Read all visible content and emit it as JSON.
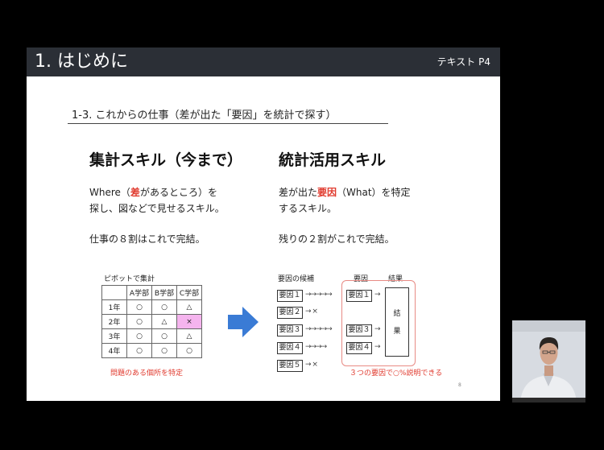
{
  "header": {
    "title": "1. はじめに",
    "reference": "テキスト P4"
  },
  "subtitle": "1-3. これからの仕事（差が出た「要因」を統計で探す）",
  "left": {
    "heading": "集計スキル（今まで）",
    "line1_pre": "Where（",
    "line1_red": "差",
    "line1_post": "があるところ）を",
    "line2": "探し、図などで見せるスキル。",
    "line3": "仕事の８割はこれで完結。"
  },
  "right": {
    "heading": "統計活用スキル",
    "line1_pre": "差が出た",
    "line1_red": "要因",
    "line1_post": "（What）を特定",
    "line2": "するスキル。",
    "line3": "残りの２割がこれで完結。"
  },
  "pivot": {
    "label": "ピボットで集計",
    "columns": [
      "",
      "A学部",
      "B学部",
      "C学部"
    ],
    "rows": [
      [
        "1年",
        "○",
        "○",
        "△"
      ],
      [
        "2年",
        "○",
        "△",
        "×"
      ],
      [
        "3年",
        "○",
        "○",
        "△"
      ],
      [
        "4年",
        "○",
        "○",
        "○"
      ]
    ],
    "caption": "問題のある個所を特定"
  },
  "factors": {
    "label_candidates": "要因の候補",
    "label_factor": "要因",
    "label_result": "結果",
    "items": [
      "要因１",
      "要因２",
      "要因３",
      "要因４",
      "要因５"
    ],
    "flow_long": "→→→→→",
    "flow_short": "→ ×",
    "flow_mid": "→→→→",
    "flow_arrow": "→",
    "selected": [
      "要因１",
      "要因３",
      "要因４"
    ],
    "result_chars": [
      "結",
      "果"
    ],
    "caption": "３つの要因で○%説明できる"
  },
  "page_number": "8",
  "colors": {
    "header_bg": "#2b2f36",
    "accent_red": "#e03a2e",
    "arrow_blue": "#3a7bd5",
    "highlight_pink": "#f5b4ee"
  }
}
